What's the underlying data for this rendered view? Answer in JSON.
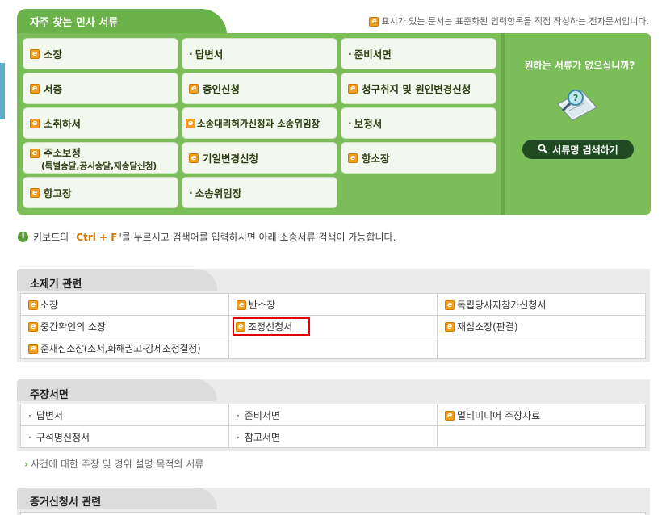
{
  "favorites": {
    "title": "자주 찾는 민사 서류",
    "note": "표시가 있는 문서는 표준화된 입력항목을 직접 작성하는 전자문서입니다.",
    "items": [
      {
        "label": "소장",
        "icon": "e-doc-icon"
      },
      {
        "label": "답변서",
        "icon": "bullet"
      },
      {
        "label": "준비서면",
        "icon": "bullet"
      },
      {
        "label": "서증",
        "icon": "e-doc-icon"
      },
      {
        "label": "증인신청",
        "icon": "e-doc-icon"
      },
      {
        "label": "청구취지 및 원인변경신청",
        "icon": "e-doc-icon"
      },
      {
        "label": "소취하서",
        "icon": "e-doc-icon"
      },
      {
        "label": "소송대리허가신청과 소송위임장",
        "icon": "e-doc-icon"
      },
      {
        "label": "보정서",
        "icon": "bullet"
      },
      {
        "label": "주소보정",
        "sub": "(특별송달,공시송달,재송달신청)",
        "icon": "e-doc-icon"
      },
      {
        "label": "기일변경신청",
        "icon": "e-doc-icon"
      },
      {
        "label": "항소장",
        "icon": "e-doc-icon"
      },
      {
        "label": "항고장",
        "icon": "e-doc-icon"
      },
      {
        "label": "소송위임장",
        "icon": "bullet"
      }
    ],
    "side_text": "원하는 서류가 없으십니까?",
    "search_button": "서류명 검색하기"
  },
  "info": {
    "prefix": "키보드의 '",
    "shortcut": "Ctrl + F",
    "suffix": "'를 누르시고 검색어를 입력하시면 아래 소송서류 검색이 가능합니다."
  },
  "sections": [
    {
      "title": "소제기 관련",
      "rows": [
        [
          {
            "label": "소장",
            "icon": "e"
          },
          {
            "label": "반소장",
            "icon": "e"
          },
          {
            "label": "독립당사자참가신청서",
            "icon": "e"
          }
        ],
        [
          {
            "label": "중간확인의 소장",
            "icon": "e"
          },
          {
            "label": "조정신청서",
            "icon": "e",
            "highlight": true
          },
          {
            "label": "재심소장(판결)",
            "icon": "e"
          }
        ],
        [
          {
            "label": "준재심소장(조서,화해권고·강제조정결정)",
            "icon": "e"
          },
          {
            "label": "",
            "icon": ""
          },
          {
            "label": "",
            "icon": ""
          }
        ]
      ]
    },
    {
      "title": "주장서면",
      "rows": [
        [
          {
            "label": "답변서",
            "icon": "bullet"
          },
          {
            "label": "준비서면",
            "icon": "bullet"
          },
          {
            "label": "멀티미디어 주장자료",
            "icon": "e"
          }
        ],
        [
          {
            "label": "구석명신청서",
            "icon": "bullet"
          },
          {
            "label": "참고서면",
            "icon": "bullet"
          },
          {
            "label": "",
            "icon": ""
          }
        ]
      ],
      "caption": "사건에 대한 주장 및 경위 설명 목적의 서류"
    },
    {
      "title": "증거신청서 관련"
    }
  ],
  "colors": {
    "panel_green": "#7bbd58",
    "highlight_red": "#e00000",
    "button_dark": "#1f4a22"
  }
}
